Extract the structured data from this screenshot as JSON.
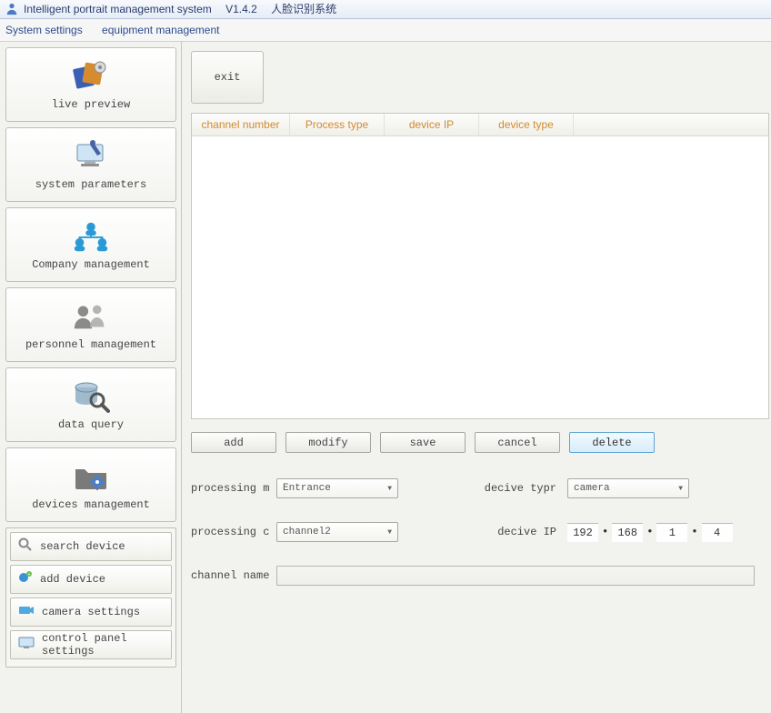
{
  "title": {
    "app_name": "Intelligent portrait management system",
    "version": "V1.4.2",
    "cn_subtitle": "人脸识别系统"
  },
  "menu": {
    "system_settings": "System settings",
    "equipment_management": "equipment management"
  },
  "sidebar": {
    "items": [
      {
        "label": "live preview"
      },
      {
        "label": "system parameters"
      },
      {
        "label": "Company management"
      },
      {
        "label": "personnel management"
      },
      {
        "label": "data query"
      },
      {
        "label": "devices management"
      }
    ],
    "subitems": [
      {
        "label": "search device"
      },
      {
        "label": "add device"
      },
      {
        "label": "camera settings"
      },
      {
        "label": "control panel settings"
      }
    ]
  },
  "toolbar": {
    "exit": "exit"
  },
  "table": {
    "columns": [
      "channel number",
      "Process type",
      "device IP",
      "device type"
    ]
  },
  "actions": {
    "add": "add",
    "modify": "modify",
    "save": "save",
    "cancel": "cancel",
    "delete": "delete"
  },
  "form": {
    "processing_m_label": "processing m",
    "processing_m_value": "Entrance",
    "device_type_label": "decive typr",
    "device_type_value": "camera",
    "processing_c_label": "processing c",
    "processing_c_value": "channel2",
    "device_ip_label": "decive IP",
    "device_ip_parts": [
      "192",
      "168",
      "1",
      "4"
    ],
    "channel_name_label": "channel name",
    "channel_name_value": ""
  }
}
